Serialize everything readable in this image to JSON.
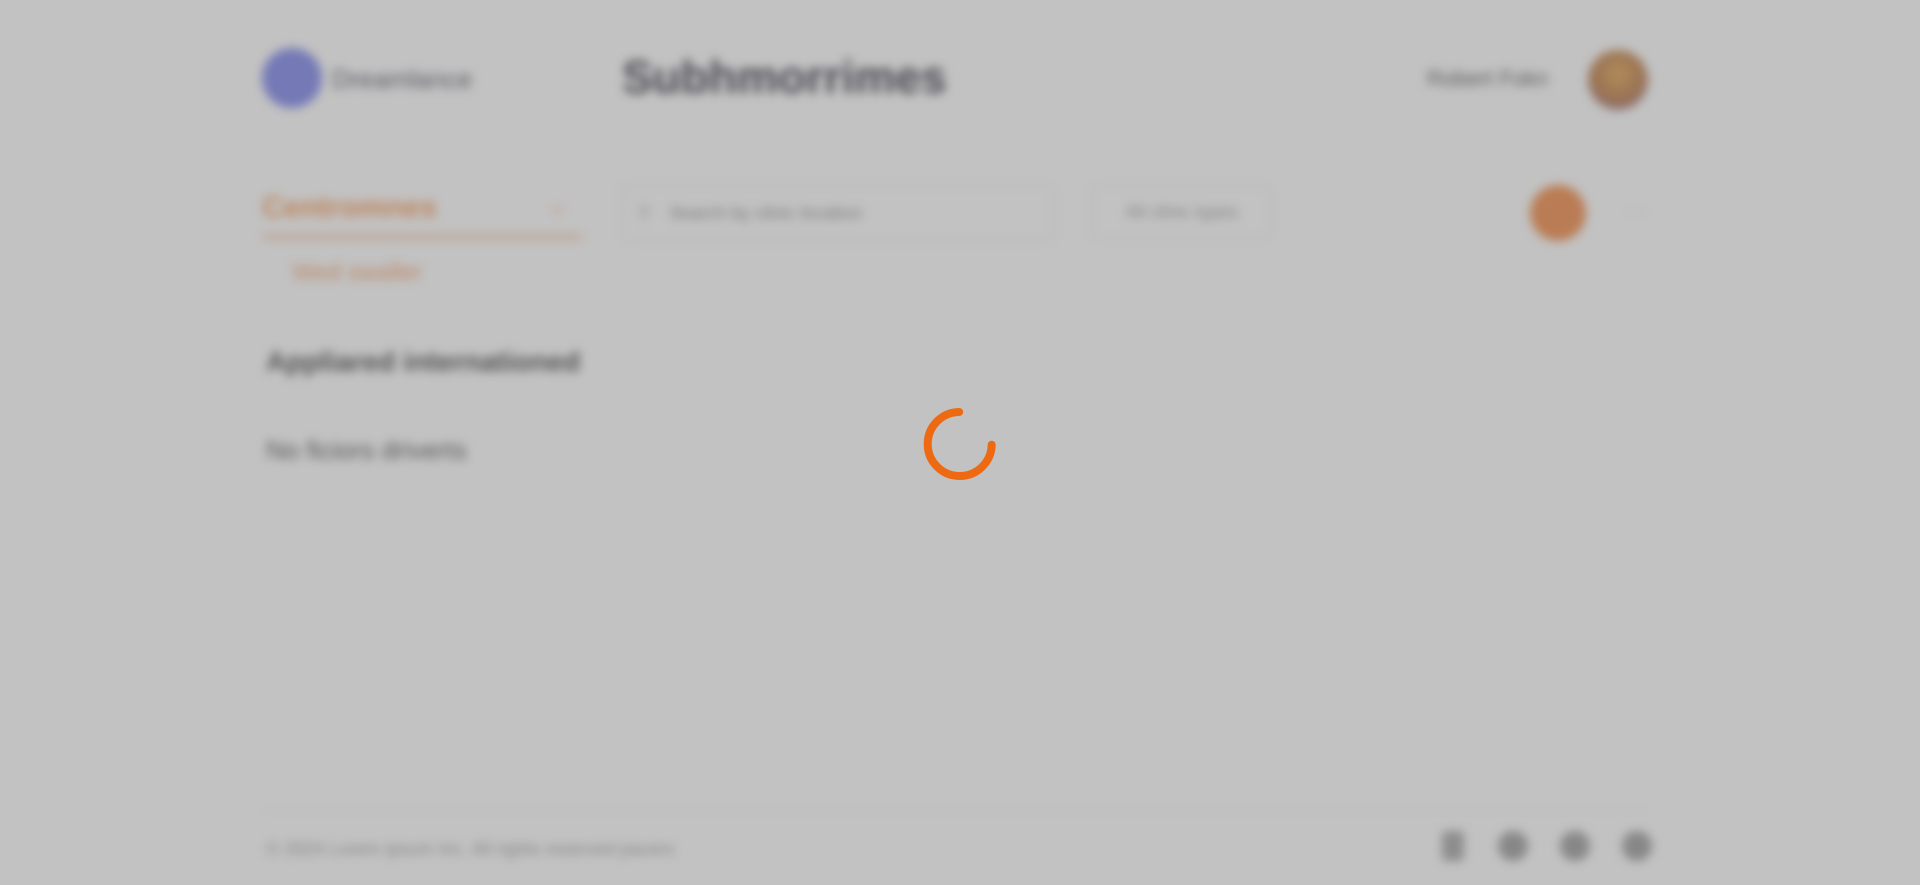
{
  "header": {
    "logo_text": "Dreamlance",
    "page_heading": "Subhmorrimes",
    "user_name": "Robert Fokn"
  },
  "toolbar": {
    "active_tab": "Centromnes",
    "sub_tab": "Wed swaller",
    "search_placeholder": "Search by clinic location",
    "filter_label": "All clinic types",
    "more_label": "⋯"
  },
  "main": {
    "section_title": "Appliared internationed",
    "empty_text": "No ficiors driverts"
  },
  "footer": {
    "copyright": "© 2024 Lorem ipsum Inc. All rights reserved pacers"
  },
  "overlay": {
    "state": "loading",
    "spinner_color": "#ee6a12",
    "accent": "#f07a2c",
    "brand": "#6b74e8"
  }
}
